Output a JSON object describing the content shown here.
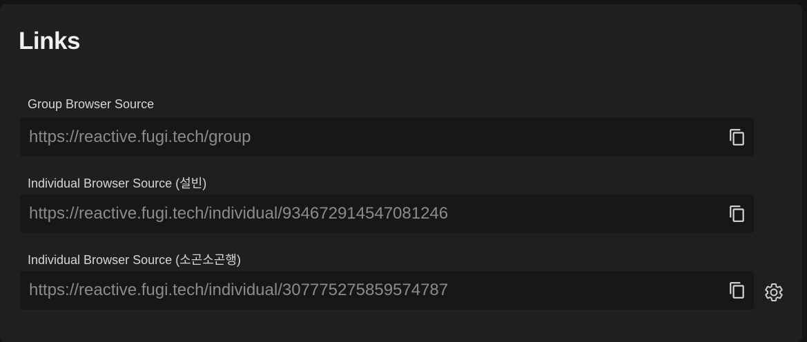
{
  "section": {
    "title": "Links"
  },
  "links": [
    {
      "label": "Group Browser Source",
      "url": "https://reactive.fugi.tech/group"
    },
    {
      "label": "Individual Browser Source (설빈)",
      "url": "https://reactive.fugi.tech/individual/934672914547081246"
    },
    {
      "label": "Individual Browser Source (소곤소곤행)",
      "url": "https://reactive.fugi.tech/individual/307775275859574787"
    }
  ],
  "icons": {
    "copy": "copy-icon",
    "settings": "gear-icon"
  },
  "colors": {
    "panel_background": "#1f1f1f",
    "field_background": "#171717",
    "title_text": "#f2f2f2",
    "url_text": "#8b8b8b"
  }
}
